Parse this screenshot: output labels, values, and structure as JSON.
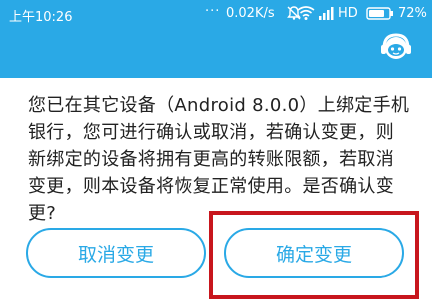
{
  "status_bar": {
    "time": "上午10:26",
    "dots": "···",
    "net_speed": "0.02K/s",
    "network_type": "HD",
    "battery_percent": "72%",
    "icons": [
      "alarm-off-icon",
      "wifi-icon",
      "signal-icon",
      "battery-icon"
    ]
  },
  "header": {
    "mascot_icon": "customer-service-mascot-icon",
    "background_color": "#2aa9e6"
  },
  "dialog": {
    "message": "您已在其它设备（Android 8.0.0）上绑定手机银行，您可进行确认或取消，若确认变更，则新绑定的设备将拥有更高的转账限额，若取消变更，则本设备将恢复正常使用。是否确认变更?",
    "cancel_label": "取消变更",
    "confirm_label": "确定变更",
    "accent_color": "#2aa9e6",
    "highlight_color": "#c8161d"
  }
}
